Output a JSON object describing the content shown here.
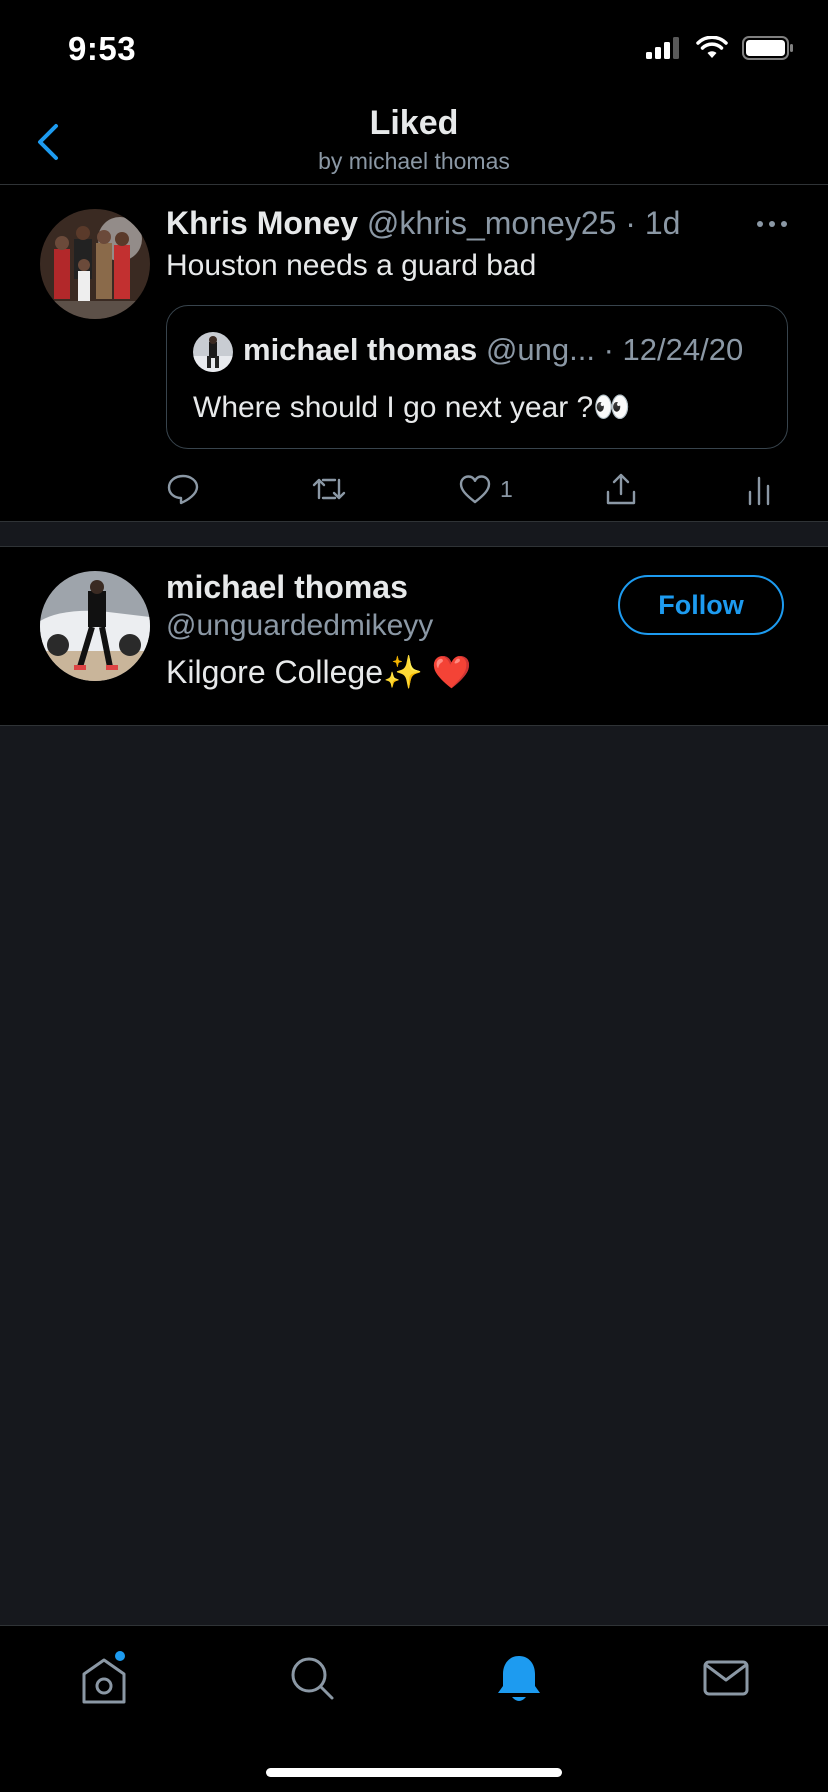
{
  "status_bar": {
    "time": "9:53"
  },
  "header": {
    "title": "Liked",
    "subtitle": "by michael thomas"
  },
  "tweet": {
    "author_name": "Khris Money",
    "author_handle": "@khris_money25",
    "separator": "·",
    "age": "1d",
    "text": "Houston needs a guard bad",
    "quote": {
      "author_name": "michael thomas",
      "author_handle": "@ung...",
      "date": "· 12/24/20",
      "text": "Where should I go next year ?👀"
    },
    "like_count": "1"
  },
  "user": {
    "name": "michael thomas",
    "handle": "@unguardedmikeyy",
    "bio": "Kilgore College✨ ❤️",
    "follow_label": "Follow"
  },
  "tabs": [
    {
      "name": "home",
      "icon": "home-icon",
      "has_badge": true
    },
    {
      "name": "search",
      "icon": "search-icon"
    },
    {
      "name": "notifications",
      "icon": "bell-icon",
      "active": true
    },
    {
      "name": "messages",
      "icon": "mail-icon"
    }
  ],
  "colors": {
    "accent": "#1d9bf0",
    "background": "#000000",
    "empty_area": "#16181d",
    "muted_text": "#8b98a5"
  }
}
